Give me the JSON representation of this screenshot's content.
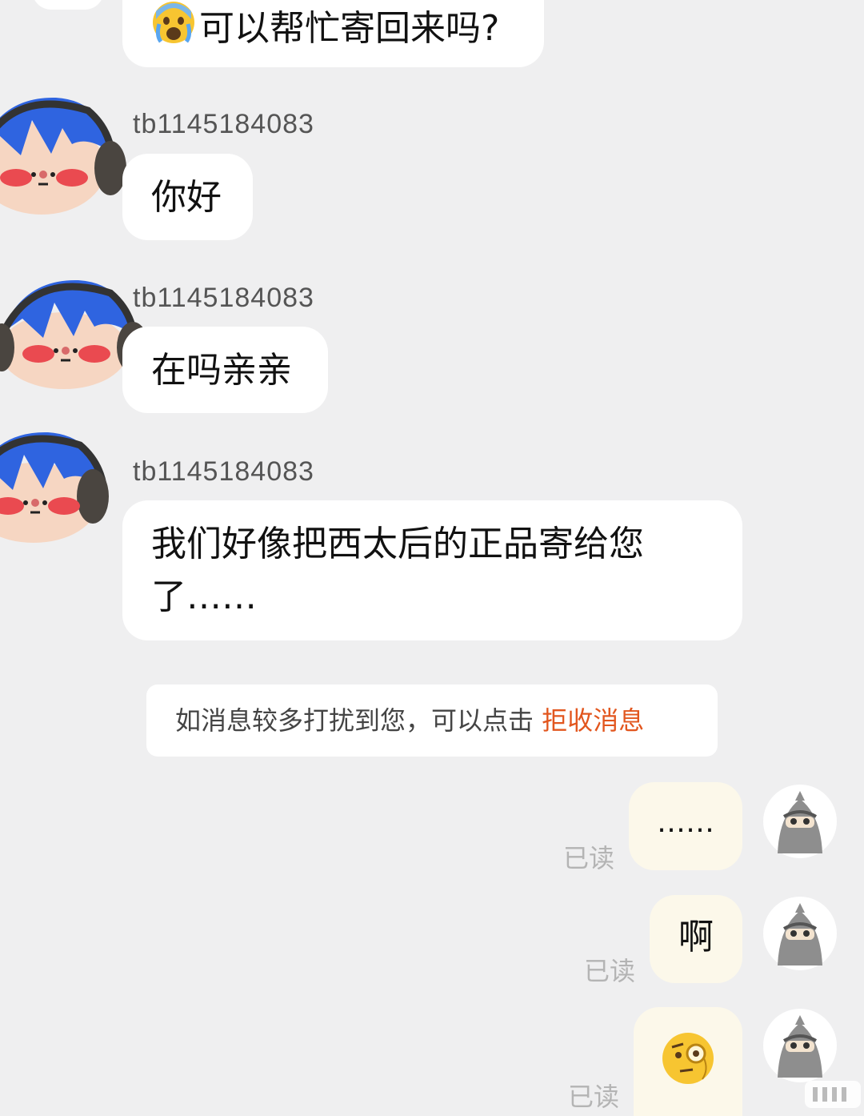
{
  "messages": {
    "m0": {
      "text": "可以帮忙寄回来吗?",
      "emoji": "crying-face"
    },
    "m1": {
      "sender": "tb1145184083",
      "text": "你好"
    },
    "m2": {
      "sender": "tb1145184083",
      "text": "在吗亲亲"
    },
    "m3": {
      "sender": "tb1145184083",
      "line1": "我们好像把西太后的正品寄给您",
      "line2": "了……"
    }
  },
  "notice": {
    "text": "如消息较多打扰到您，可以点击",
    "link": "拒收消息"
  },
  "my_messages": {
    "r1": {
      "text": "……",
      "status": "已读"
    },
    "r2": {
      "text": "啊",
      "status": "已读"
    },
    "r3": {
      "emoji": "face-with-monocle",
      "status": "已读"
    }
  },
  "colors": {
    "background": "#efeff0",
    "their_bubble": "#ffffff",
    "my_bubble": "#fcf8ea",
    "link": "#e2561e",
    "read_status": "#b4b4b4"
  }
}
